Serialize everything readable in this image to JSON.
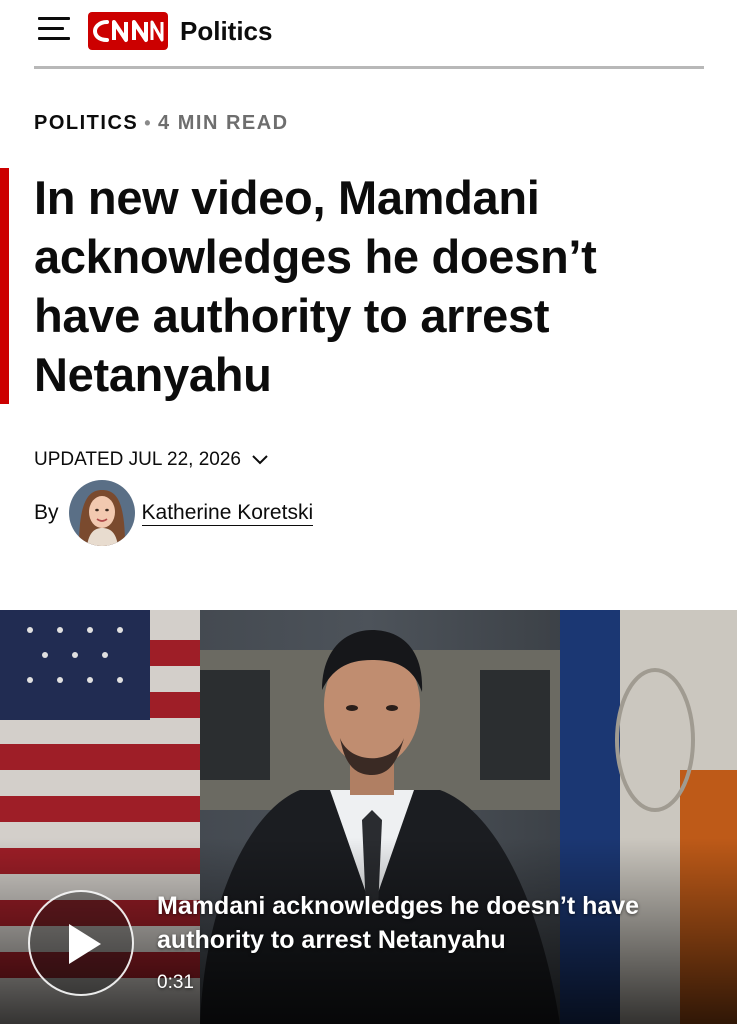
{
  "header": {
    "logo_text": "CNN",
    "section": "Politics"
  },
  "article": {
    "category": "POLITICS",
    "separator": "•",
    "read_time": "4 MIN READ",
    "headline": "In new video, Mamdani acknowledges he doesn’t have authority to arrest Netanyahu",
    "updated": "UPDATED JUL 22, 2026",
    "by_label": "By",
    "author": "Katherine Koretski"
  },
  "video": {
    "title": "Mamdani acknowledges he doesn’t have authority to arrest Netanyahu",
    "duration": "0:31"
  },
  "colors": {
    "brand_red": "#cc0000",
    "text": "#0c0c0c",
    "muted": "#6e6e6e",
    "rule": "#b8b8b8"
  },
  "icons": [
    "menu-icon",
    "chevron-down-icon",
    "play-icon"
  ]
}
